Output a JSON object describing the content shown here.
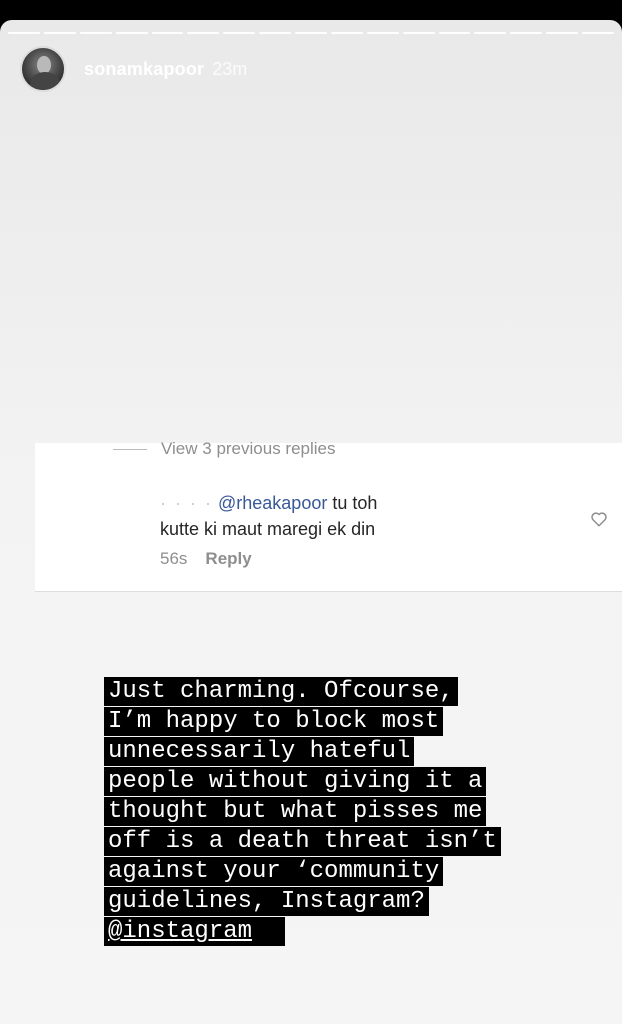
{
  "story": {
    "progress_segments": 17,
    "username": "sonamkapoor",
    "time": "23m"
  },
  "comment": {
    "view_replies": "View 3 previous replies",
    "blurred_name": "· ·  · ·",
    "mention": "@rheakapoor",
    "text_line1_rest": " tu toh",
    "text_line2": "kutte ki maut maregi ek din",
    "age": "56s",
    "reply_label": "Reply"
  },
  "caption": {
    "lines": [
      "Just charming. Ofcourse,",
      "I’m happy to block most",
      "unnecessarily hateful",
      "people without giving it a",
      "thought but what pisses me",
      "off is a death threat isn’t",
      "against your ‘community",
      "guidelines, Instagram?"
    ],
    "link": "@instagram"
  }
}
